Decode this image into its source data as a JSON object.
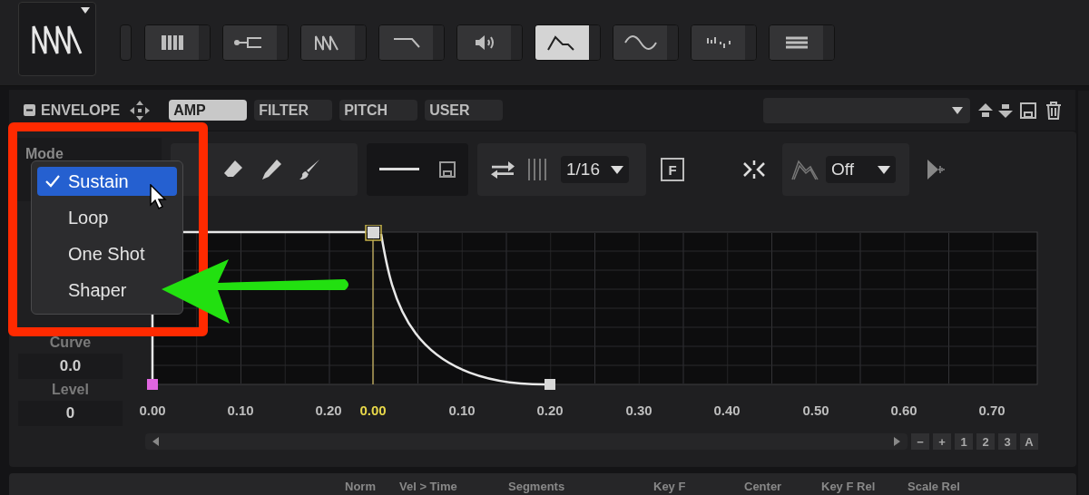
{
  "module_bar": {
    "buttons": [
      {
        "kind": "keys",
        "selected": false
      },
      {
        "kind": "fork",
        "selected": false
      },
      {
        "kind": "saw",
        "selected": false
      },
      {
        "kind": "filter",
        "selected": false
      },
      {
        "kind": "speaker",
        "selected": false
      },
      {
        "kind": "envelope",
        "selected": true
      },
      {
        "kind": "sine",
        "selected": false
      },
      {
        "kind": "steps",
        "selected": false
      },
      {
        "kind": "list",
        "selected": false
      }
    ]
  },
  "envelope": {
    "title": "ENVELOPE",
    "tabs": [
      {
        "label": "AMP",
        "selected": true
      },
      {
        "label": "FILTER",
        "selected": false
      },
      {
        "label": "PITCH",
        "selected": false
      },
      {
        "label": "USER",
        "selected": false
      }
    ]
  },
  "toolbar": {
    "mode_label": "Mode",
    "grid": "1/16",
    "fit_button": "F",
    "snap": "Off"
  },
  "params": [
    {
      "label": "Curve",
      "value": "0.0"
    },
    {
      "label": "Level",
      "value": "0"
    }
  ],
  "mode_menu": {
    "items": [
      {
        "label": "Sustain",
        "selected": true
      },
      {
        "label": "Loop",
        "selected": false
      },
      {
        "label": "One Shot",
        "selected": false
      },
      {
        "label": "Shaper",
        "selected": false
      }
    ]
  },
  "axis_labels": [
    {
      "text": "0.00",
      "highlighted": false
    },
    {
      "text": "0.10",
      "highlighted": false
    },
    {
      "text": "0.20",
      "highlighted": false
    },
    {
      "text": "0.00",
      "highlighted": true
    },
    {
      "text": "0.10",
      "highlighted": false
    },
    {
      "text": "0.20",
      "highlighted": false
    },
    {
      "text": "0.30",
      "highlighted": false
    },
    {
      "text": "0.40",
      "highlighted": false
    },
    {
      "text": "0.50",
      "highlighted": false
    },
    {
      "text": "0.60",
      "highlighted": false
    },
    {
      "text": "0.70",
      "highlighted": false
    }
  ],
  "zoom_buttons": [
    "−",
    "+",
    "1",
    "2",
    "3",
    "A"
  ],
  "bottom_labels": [
    "Norm",
    "Vel > Time",
    "Segments",
    "Key F",
    "Center",
    "Key F Rel",
    "Scale Rel"
  ]
}
